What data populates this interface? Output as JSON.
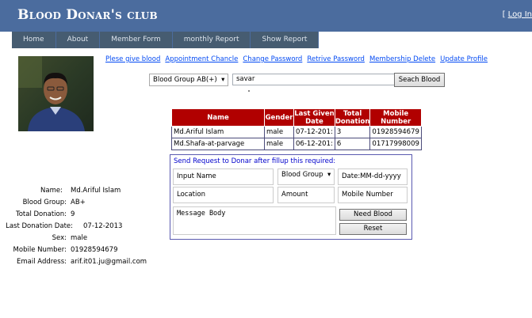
{
  "header": {
    "title": "Blood Donar's club",
    "login": "Log In"
  },
  "nav": [
    "Home",
    "About",
    "Member Form",
    "monthly Report",
    "Show Report"
  ],
  "links": [
    "Plese give blood",
    "Appointment Chancle",
    "Change Password",
    "Retrive Password",
    "Membership Delete",
    "Update Profile"
  ],
  "search": {
    "blood_group": "Blood Group AB(+)",
    "location": "savar",
    "button": "Seach Blood"
  },
  "table": {
    "headers": [
      "Name",
      "Gender",
      "Last Given Date",
      "Total Donation",
      "Mobile Number"
    ],
    "rows": [
      [
        "Md.Ariful Islam",
        "male",
        "07-12-201:",
        "3",
        "01928594679"
      ],
      [
        "Md.Shafa-at-parvage",
        "male",
        "06-12-201:",
        "6",
        "01717998009"
      ]
    ]
  },
  "request": {
    "title": "Send Request to Donar after fillup this required:",
    "name": "Input Name",
    "blood_group": "Blood Group",
    "date": "Date:MM-dd-yyyy",
    "location": "Location",
    "amount": "Amount",
    "mobile": "Mobile Number",
    "message": "Message Body",
    "need_button": "Need Blood",
    "reset_button": "Reset"
  },
  "profile": [
    {
      "label": "Name:",
      "value": "Md.Ariful Islam"
    },
    {
      "label": "Blood Group:",
      "value": "AB+"
    },
    {
      "label": "Total Donation:",
      "value": "9"
    },
    {
      "label": "Last Donation Date:",
      "value": "07-12-2013"
    },
    {
      "label": "Sex:",
      "value": "male"
    },
    {
      "label": "Mobile Number:",
      "value": "01928594679"
    },
    {
      "label": "Email Address:",
      "value": "arif.it01.ju@gmail.com"
    }
  ],
  "colors": {
    "header": "#4b6c9e",
    "nav": "#465c71",
    "table_header": "#b10000",
    "link": "#034af3"
  }
}
